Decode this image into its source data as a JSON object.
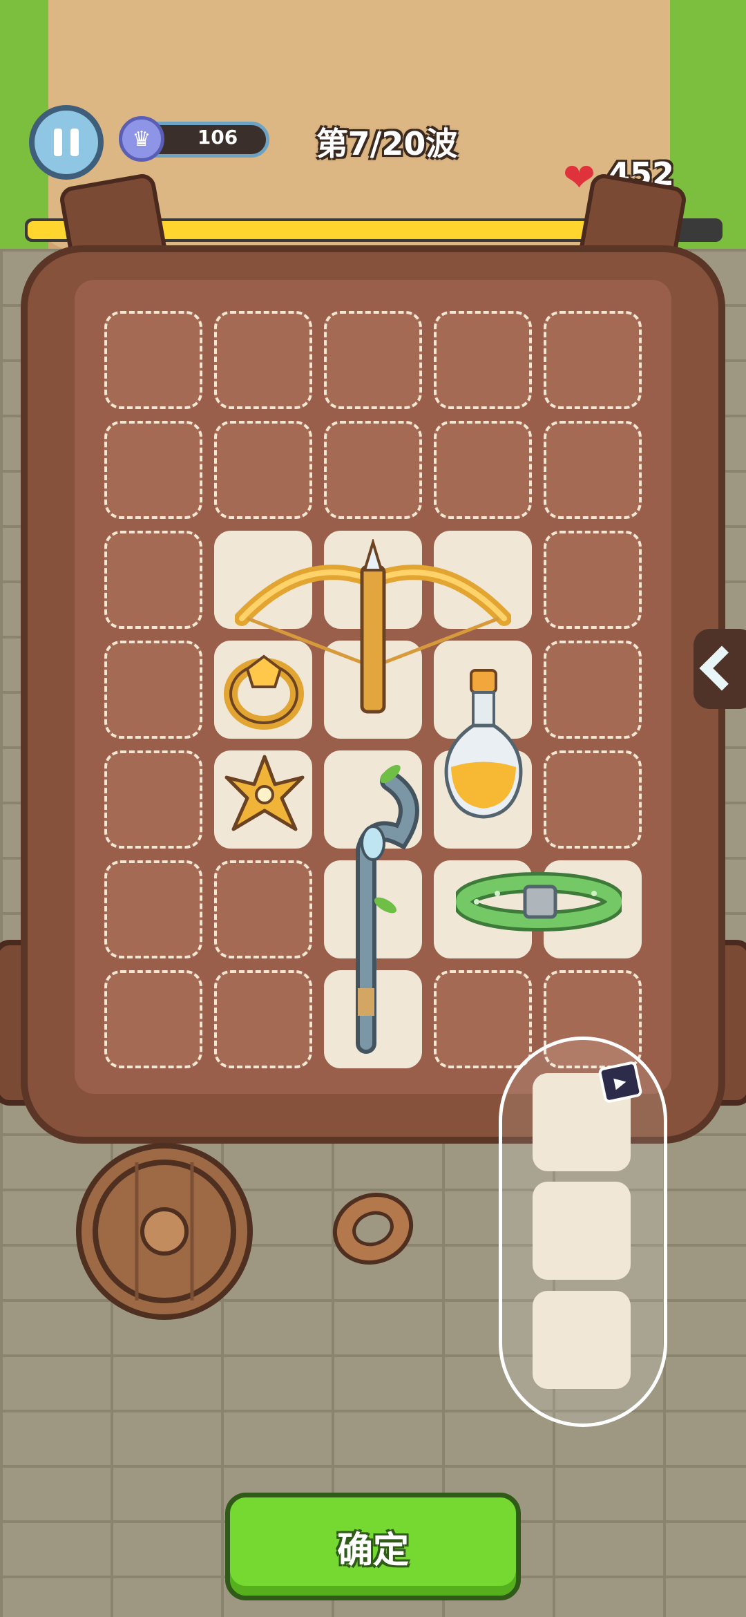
{
  "hud": {
    "currency_value": "106",
    "currency_icon": "crown-gem-icon",
    "wave_label": "第7/20波",
    "hp_value": "452",
    "hp_icon": "heart-icon",
    "hp_fill_fraction": 0.9
  },
  "backpack": {
    "rows": 7,
    "cols": 5,
    "items": [
      {
        "name": "crossbow",
        "icon": "crossbow-icon"
      },
      {
        "name": "ring",
        "icon": "ring-icon"
      },
      {
        "name": "potion",
        "icon": "potion-icon"
      },
      {
        "name": "shuriken",
        "icon": "shuriken-icon"
      },
      {
        "name": "staff",
        "icon": "staff-icon"
      },
      {
        "name": "collar",
        "icon": "collar-icon"
      }
    ]
  },
  "ground_items": [
    {
      "name": "shield",
      "icon": "round-shield-icon"
    },
    {
      "name": "bracelet",
      "icon": "bracelet-icon"
    }
  ],
  "storage": {
    "slots": 3,
    "ad_icon": "video-ad-icon"
  },
  "confirm_label": "确定",
  "colors": {
    "accent_green": "#76d932",
    "hp_yellow": "#ffd52e",
    "bag_brown": "#86523b"
  }
}
